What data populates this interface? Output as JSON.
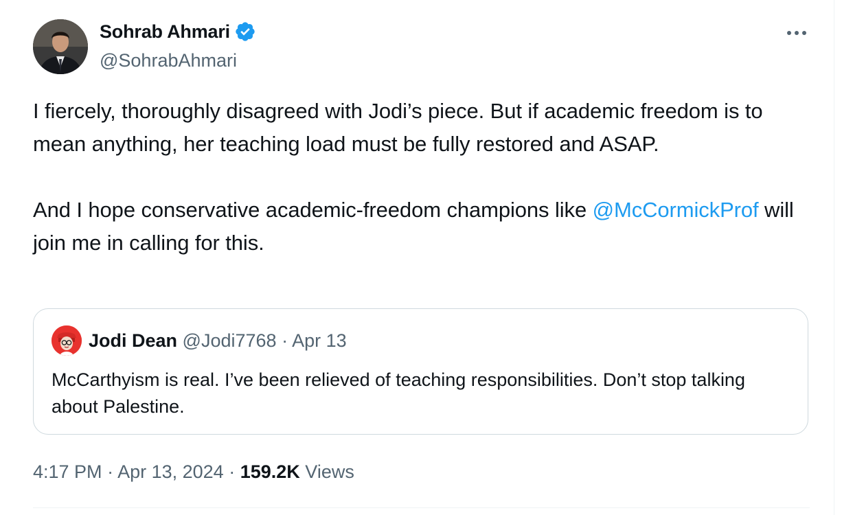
{
  "author": {
    "name": "Sohrab Ahmari",
    "handle": "@SohrabAhmari",
    "verified": true,
    "verified_color": "#1d9bf0"
  },
  "more_icon": "more-horizontal-icon",
  "tweet": {
    "paragraph1": "I fiercely, thoroughly disagreed with Jodi’s piece. But if academic freedom is to mean anything, her teaching load must be fully restored and ASAP.",
    "paragraph2_prefix": "And I hope conservative academic-freedom champions like ",
    "mention": "@McCormickProf",
    "paragraph2_suffix": " will join me in calling for this."
  },
  "quote": {
    "name": "Jodi Dean",
    "handle": "@Jodi7768",
    "separator": " · ",
    "date": "Apr 13",
    "text": "McCarthyism is real. I’ve been relieved of teaching responsibilities. Don’t stop talking about Palestine."
  },
  "meta": {
    "time": "4:17 PM",
    "separator": " · ",
    "date": "Apr 13, 2024",
    "views_count": "159.2K",
    "views_label": "Views"
  },
  "colors": {
    "text": "#0f1419",
    "secondary": "#536471",
    "link": "#1d9bf0",
    "border": "#cfd9de"
  }
}
